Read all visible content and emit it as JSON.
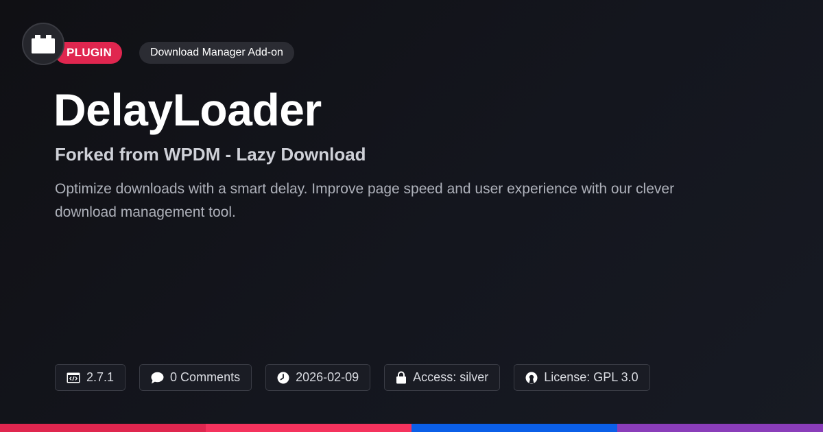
{
  "header": {
    "badge_type": "PLUGIN",
    "badge_category": "Download Manager Add-on",
    "logo_icon": "plugin-block-icon"
  },
  "main": {
    "title": "DelayLoader",
    "subtitle": "Forked from WPDM - Lazy Download",
    "description": "Optimize downloads with a smart delay. Improve page speed and user experience with our clever download management tool."
  },
  "meta": {
    "version": "2.7.1",
    "comments": "0 Comments",
    "date": "2026-02-09",
    "access": "Access: silver",
    "license": "License: GPL 3.0",
    "icons": [
      "code-window-icon",
      "comment-bubble-icon",
      "clock-icon",
      "lock-icon",
      "open-source-icon"
    ]
  },
  "colors": {
    "badge_plugin": "#e0264f",
    "bar_segments": [
      "#e0264f",
      "#f5335e",
      "#0b5fe8",
      "#8a3dba"
    ]
  }
}
